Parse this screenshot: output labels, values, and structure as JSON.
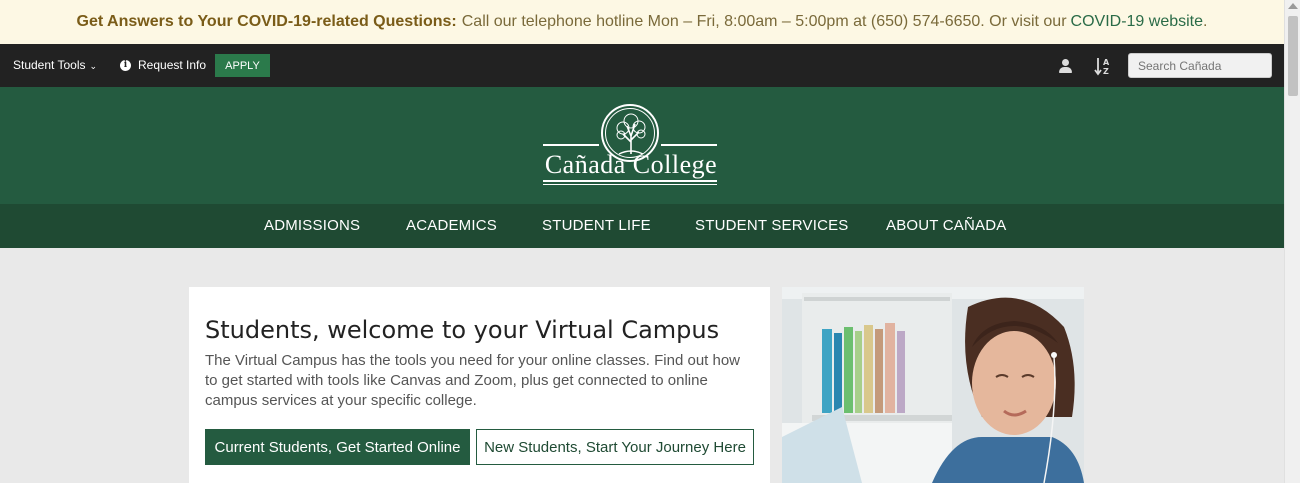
{
  "alert": {
    "heading": "Get Answers to Your COVID-19-related Questions:",
    "message": "Call our telephone hotline Mon – Fri, 8:00am – 5:00pm at (650) 574-6650. Or visit our",
    "link": "COVID-19 website",
    "trail": "."
  },
  "topbar": {
    "student_tools": "Student Tools",
    "request_info": "Request Info",
    "apply": "APPLY",
    "search_placeholder": "Search Cañada"
  },
  "logo": {
    "name": "Cañada College"
  },
  "nav": {
    "items": [
      "ADMISSIONS",
      "ACADEMICS",
      "STUDENT LIFE",
      "STUDENT SERVICES",
      "ABOUT CAÑADA"
    ]
  },
  "hero": {
    "title": "Students, welcome to your Virtual Campus",
    "body": "The Virtual Campus has the tools you need for your online classes. Find out how to get started with tools like Canvas and Zoom, plus get connected to online campus services at your specific college.",
    "primary_button": "Current Students, Get Started Online",
    "secondary_button": "New Students, Start Your Journey Here"
  },
  "colors": {
    "brand_green": "#245b40",
    "nav_green": "#1f4a33",
    "alert_bg": "#fdf8e4"
  }
}
